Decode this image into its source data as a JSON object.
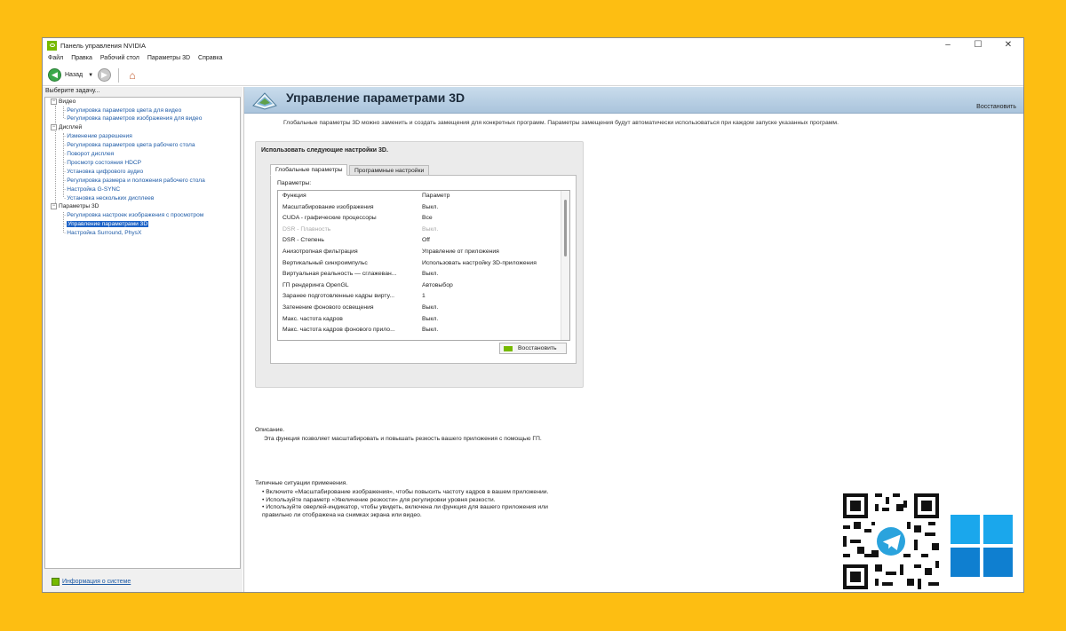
{
  "window": {
    "title": "Панель управления NVIDIA",
    "controls": {
      "minimize": "–",
      "maximize": "☐",
      "close": "✕"
    }
  },
  "menu": [
    "Файл",
    "Правка",
    "Рабочий стол",
    "Параметры 3D",
    "Справка"
  ],
  "toolbar": {
    "back_label": "Назад",
    "back_glyph": "◀",
    "forward_glyph": "▶",
    "dropdown_glyph": "▼",
    "home_glyph": "⌂"
  },
  "sidebar": {
    "task_label": "Выберите задачу...",
    "sections": [
      {
        "label": "Видео",
        "items": [
          "Регулировка параметров цвета для видео",
          "Регулировка параметров изображения для видео"
        ]
      },
      {
        "label": "Дисплей",
        "items": [
          "Изменение разрешения",
          "Регулировка параметров цвета рабочего стола",
          "Поворот дисплея",
          "Просмотр состояния HDCP",
          "Установка цифрового аудио",
          "Регулировка размера и положения рабочего стола",
          "Настройка G-SYNC",
          "Установка нескольких дисплеев"
        ]
      },
      {
        "label": "Параметры 3D",
        "items": [
          "Регулировка настроек изображения с просмотром",
          "Управление параметрами 3D",
          "Настройка Surround, PhysX"
        ]
      }
    ],
    "selected_item": "Управление параметрами 3D",
    "system_info": "Информация о системе"
  },
  "main": {
    "title": "Управление параметрами 3D",
    "restore_link": "Восстановить",
    "intro": "Глобальные параметры 3D можно заменить и создать замещения для конкретных программ. Параметры замещения будут автоматически использоваться при каждом запуске указанных программ.",
    "use_settings": "Использовать следующие настройки 3D.",
    "tabs": [
      "Глобальные параметры",
      "Программные настройки"
    ],
    "params_label": "Параметры:",
    "table": {
      "headers": [
        "Функция",
        "Параметр"
      ],
      "rows": [
        {
          "feature": "Масштабирование изображения",
          "value": "Выкл.",
          "disabled": false
        },
        {
          "feature": "CUDA - графические процессоры",
          "value": "Все",
          "disabled": false
        },
        {
          "feature": "DSR - Плавность",
          "value": "Выкл.",
          "disabled": true
        },
        {
          "feature": "DSR - Степень",
          "value": "Off",
          "disabled": false
        },
        {
          "feature": "Анизотропная фильтрация",
          "value": "Управление от приложения",
          "disabled": false
        },
        {
          "feature": "Вертикальный синхроимпульс",
          "value": "Использовать настройку 3D-приложения",
          "disabled": false
        },
        {
          "feature": "Виртуальная реальность — сглажеван...",
          "value": "Выкл.",
          "disabled": false
        },
        {
          "feature": "ГП рендеринга OpenGL",
          "value": "Автовыбор",
          "disabled": false
        },
        {
          "feature": "Заранее подготовленные кадры вирту...",
          "value": "1",
          "disabled": false
        },
        {
          "feature": "Затенение фонового освещения",
          "value": "Выкл.",
          "disabled": false
        },
        {
          "feature": "Макс. частота кадров",
          "value": "Выкл.",
          "disabled": false
        },
        {
          "feature": "Макс. частота кадров фонового прило...",
          "value": "Выкл.",
          "disabled": false
        }
      ]
    },
    "restore_button": "Восстановить",
    "description_label": "Описание.",
    "description": "Эта функция позволяет масштабировать и повышать резкость вашего приложения с помощью ГП.",
    "typical_label": "Типичные ситуации применения.",
    "typical": [
      "• Включите «Масштабирование изображения», чтобы повысить частоту кадров в вашем приложении.",
      "• Используйте параметр «Увеличение резкости» для регулировки уровня резкости.",
      "• Используйте оверлей-индикатор, чтобы увидеть, включена ли функция для вашего приложения или",
      "правильно ли отображена на снимках экрана или видео."
    ]
  },
  "colors": {
    "background": "#fdbe12",
    "nvidia_green": "#76b900",
    "selection": "#1d63c7",
    "link": "#1d5aa6"
  }
}
